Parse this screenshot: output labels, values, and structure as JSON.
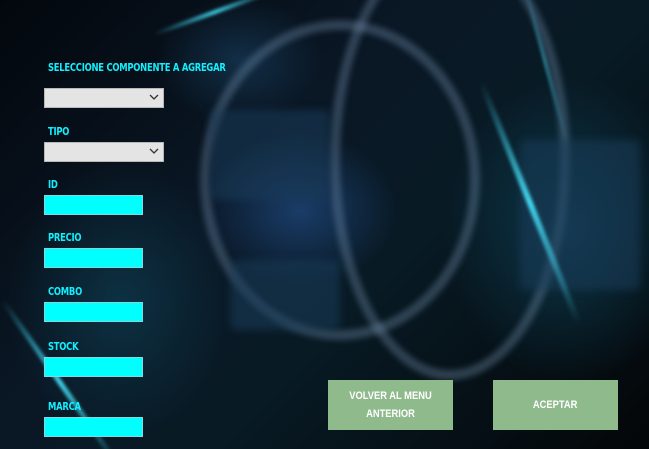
{
  "form": {
    "component_label": "SELECCIONE COMPONENTE A AGREGAR",
    "component_value": "",
    "type_label": "TIPO",
    "type_value": "",
    "id_label": "ID",
    "id_value": "",
    "price_label": "PRECIO",
    "price_value": "",
    "combo_label": "COMBO",
    "combo_value": "",
    "stock_label": "STOCK",
    "stock_value": "",
    "brand_label": "MARCA",
    "brand_value": ""
  },
  "buttons": {
    "back_label": "VOLVER AL MENU ANTERIOR",
    "accept_label": "ACEPTAR"
  },
  "colors": {
    "label_text": "#12f0ff",
    "field_background": "#00ffff",
    "select_background": "#e4e4e4",
    "button_background": "#8fba8c",
    "button_text": "#ffffff"
  },
  "icons": {
    "select_arrow": "chevron-down-icon"
  }
}
